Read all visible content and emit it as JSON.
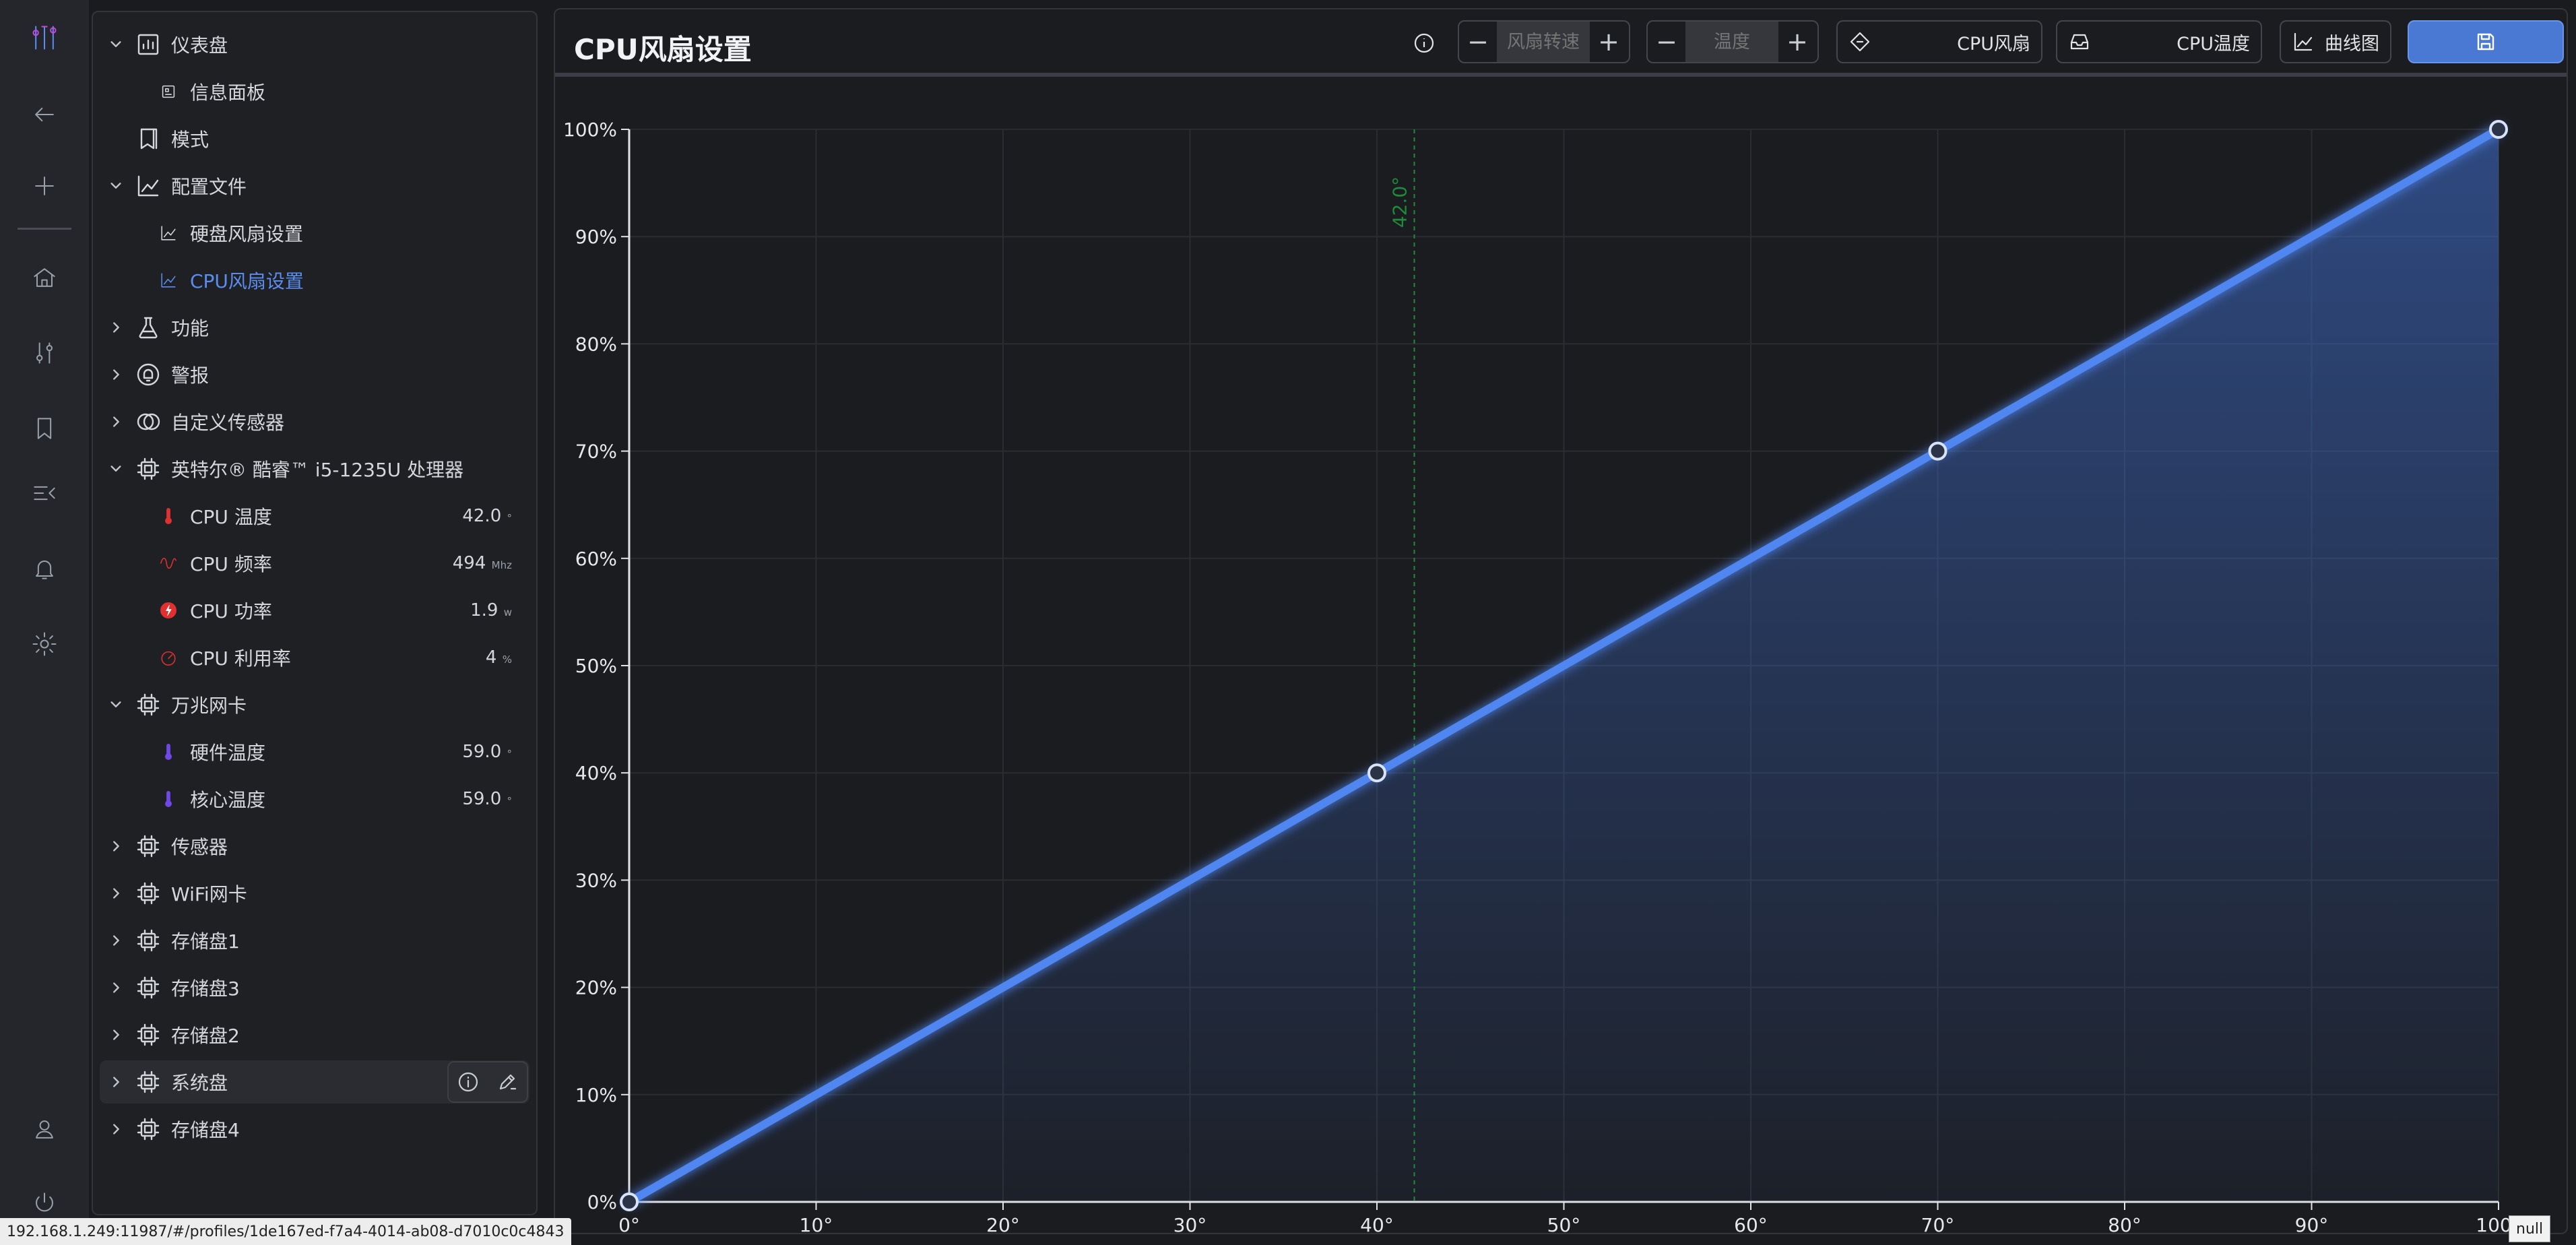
{
  "rail": {
    "items": [
      "logo-icon",
      "back-icon",
      "add-icon",
      "home-icon",
      "tune-icon",
      "bookmark-icon",
      "menu-fold-icon",
      "bell-icon",
      "gear-icon",
      "user-icon",
      "power-icon"
    ]
  },
  "nav": {
    "dashboard": "仪表盘",
    "info_board": "信息面板",
    "mode": "模式",
    "profiles": "配置文件",
    "disk_fan": "硬盘风扇设置",
    "cpu_fan": "CPU风扇设置",
    "features": "功能",
    "alerts": "警报",
    "custom_sensor": "自定义传感器",
    "cpu_group": "英特尔® 酷睿™ i5-1235U 处理器",
    "cpu_temp": {
      "label": "CPU 温度",
      "value": "42.0",
      "unit": "°"
    },
    "cpu_freq": {
      "label": "CPU 频率",
      "value": "494",
      "unit": "Mhz"
    },
    "cpu_power": {
      "label": "CPU 功率",
      "value": "1.9",
      "unit": "w"
    },
    "cpu_usage": {
      "label": "CPU 利用率",
      "value": "4",
      "unit": "%"
    },
    "nic_group": "万兆网卡",
    "hw_temp": {
      "label": "硬件温度",
      "value": "59.0",
      "unit": "°"
    },
    "core_temp": {
      "label": "核心温度",
      "value": "59.0",
      "unit": "°"
    },
    "sensors": "传感器",
    "wifi": "WiFi网卡",
    "disk1": "存储盘1",
    "disk3": "存储盘3",
    "disk2": "存储盘2",
    "system_disk": "系统盘",
    "disk4": "存储盘4"
  },
  "toolbar": {
    "title": "CPU风扇设置",
    "fan_speed_placeholder": "风扇转速",
    "temp_placeholder": "温度",
    "minus": "−",
    "plus": "+",
    "fan_source": "CPU风扇",
    "temp_source": "CPU温度",
    "chart_mode": "曲线图"
  },
  "colors": {
    "accent": "#5b8def",
    "line": "#4f86f0",
    "marker_line": "#1f8a3a",
    "thermo_red": "#e03131",
    "thermo_purple": "#7048e8"
  },
  "chart_data": {
    "type": "line",
    "x": [
      0,
      40,
      70,
      100
    ],
    "y": [
      0,
      40,
      70,
      100
    ],
    "xlim": [
      0,
      100
    ],
    "ylim": [
      0,
      100
    ],
    "x_ticks": [
      "0°",
      "10°",
      "20°",
      "30°",
      "40°",
      "50°",
      "60°",
      "70°",
      "80°",
      "90°",
      "100°"
    ],
    "y_ticks": [
      "0%",
      "10%",
      "20%",
      "30%",
      "40%",
      "50%",
      "60%",
      "70%",
      "80%",
      "90%",
      "100%"
    ],
    "marker": {
      "x": 42.0,
      "label": "42.0°"
    },
    "grid": true
  },
  "status": {
    "url": "192.168.1.249:11987/#/profiles/1de167ed-f7a4-4014-ab08-d7010c0c4843",
    "badge": "null"
  }
}
